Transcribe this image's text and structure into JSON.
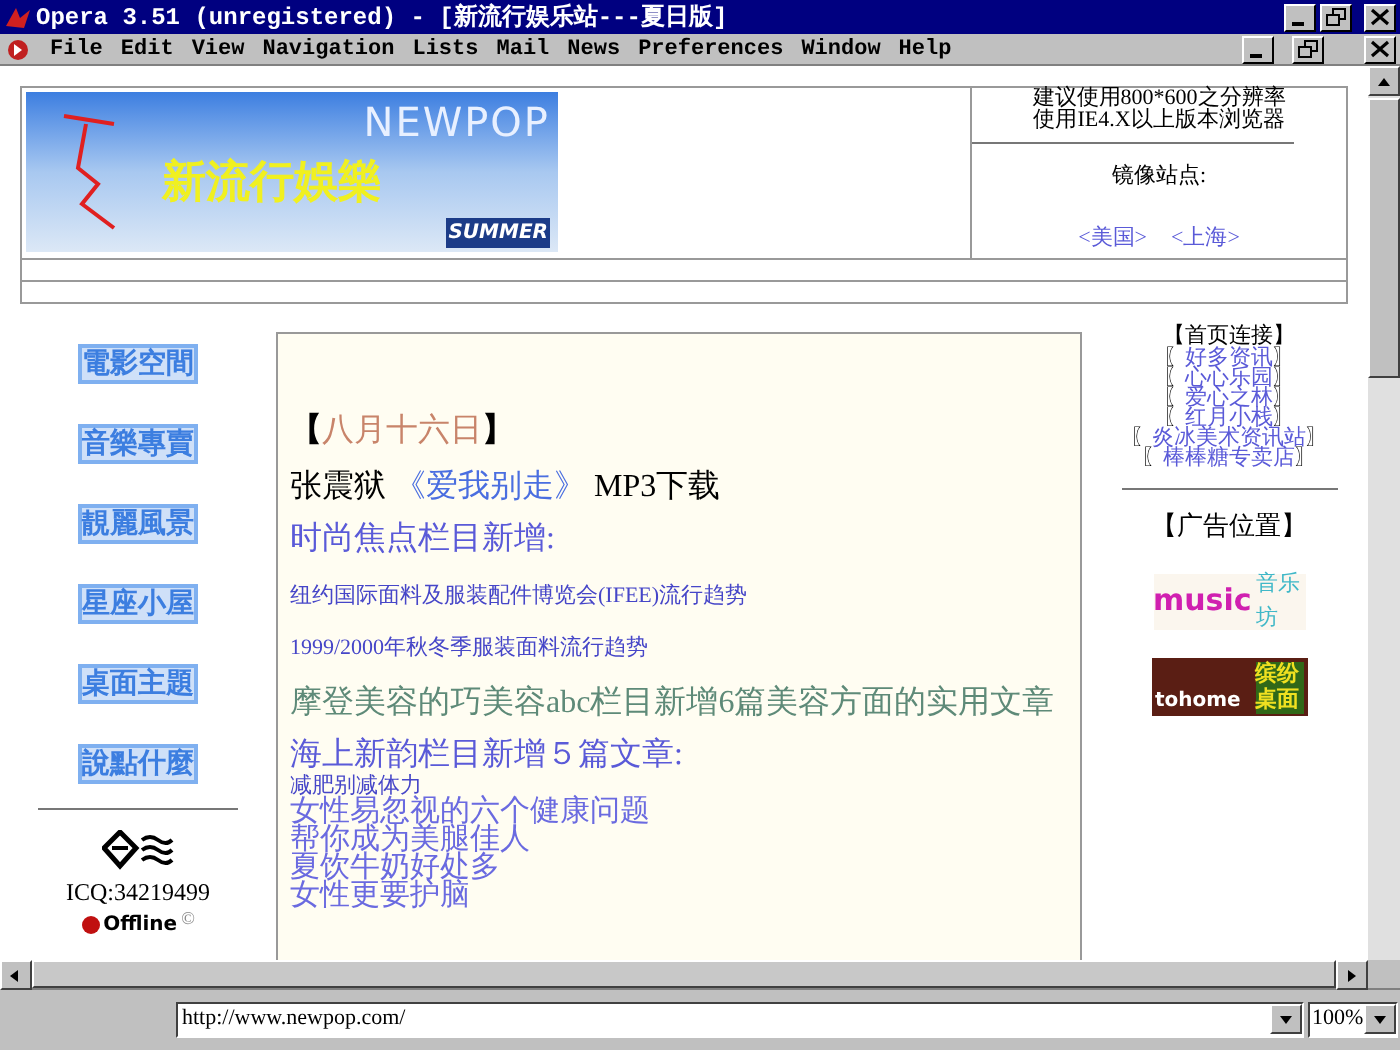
{
  "window": {
    "title": "Opera 3.51 (unregistered) - [新流行娱乐站---夏日版]"
  },
  "menu": [
    {
      "label": "File"
    },
    {
      "label": "Edit"
    },
    {
      "label": "View"
    },
    {
      "label": "Navigation"
    },
    {
      "label": "Lists"
    },
    {
      "label": "Mail"
    },
    {
      "label": "News"
    },
    {
      "label": "Preferences"
    },
    {
      "label": "Window"
    },
    {
      "label": "Help"
    }
  ],
  "banner": {
    "brand": "NEWPOP",
    "title": "新流行娛樂",
    "season": "SUMMER"
  },
  "header_info": {
    "lines": [
      "建议使用800*600之分辨率",
      "使用IE4.X以上版本浏览器"
    ],
    "mirror_label": "镜像站点:",
    "mirrors": [
      "<美国>",
      "<上海>"
    ]
  },
  "nav": [
    {
      "label": "電影空間"
    },
    {
      "label": "音樂專賣"
    },
    {
      "label": "靚麗風景"
    },
    {
      "label": "星座小屋"
    },
    {
      "label": "桌面主題"
    },
    {
      "label": "說點什麼"
    }
  ],
  "icq": {
    "number": "ICQ:34219499",
    "status": "Offline",
    "mark": "©",
    "online": false
  },
  "content": [
    {
      "kind": "date",
      "open": "【",
      "text": "八月十六日",
      "close": "】"
    },
    {
      "kind": "song",
      "artist": "张震狱",
      "title": "《爱我别走》",
      "suffix": "MP3下载"
    },
    {
      "kind": "heading",
      "text": "时尚焦点栏目新增:"
    },
    {
      "kind": "small",
      "text": "纽约国际面料及服装配件博览会(IFEE)流行趋势"
    },
    {
      "kind": "small",
      "text": "1999/2000年秋冬季服装面料流行趋势"
    },
    {
      "kind": "feature",
      "text": "摩登美容的巧美容abc栏目新增6篇美容方面的实用文章"
    },
    {
      "kind": "heading",
      "text": "海上新韵栏目新增５篇文章:"
    },
    {
      "kind": "tiny",
      "text": "减肥别减体力"
    },
    {
      "kind": "link",
      "text": "女性易忽视的六个健康问题"
    },
    {
      "kind": "link",
      "text": "帮你成为美腿佳人"
    },
    {
      "kind": "link",
      "text": "夏饮牛奶好处多"
    },
    {
      "kind": "link",
      "text": "女性更要护脑"
    }
  ],
  "links": {
    "title": "【首页连接】",
    "items": [
      {
        "open": "〖",
        "text": "好多资讯",
        "close": "〗"
      },
      {
        "open": "〖",
        "text": "心心乐园",
        "close": "〗"
      },
      {
        "open": "〖",
        "text": "爱心之林",
        "close": "〗"
      },
      {
        "open": "〖",
        "text": "红月小栈",
        "close": "〗"
      },
      {
        "open": "〖",
        "text": "炎冰美术资讯站",
        "close": "〗"
      },
      {
        "open": "〖",
        "text": "棒棒糖专卖店",
        "close": "〗"
      }
    ]
  },
  "ads": {
    "title": "【广告位置】",
    "items": [
      {
        "kind": "music",
        "text": "music",
        "sub": "音乐坊"
      },
      {
        "kind": "desktop",
        "text": "tohome",
        "sub": "缤纷桌面"
      }
    ]
  },
  "address": {
    "value": "http://www.newpop.com/"
  },
  "zoom": {
    "value": "100%"
  }
}
